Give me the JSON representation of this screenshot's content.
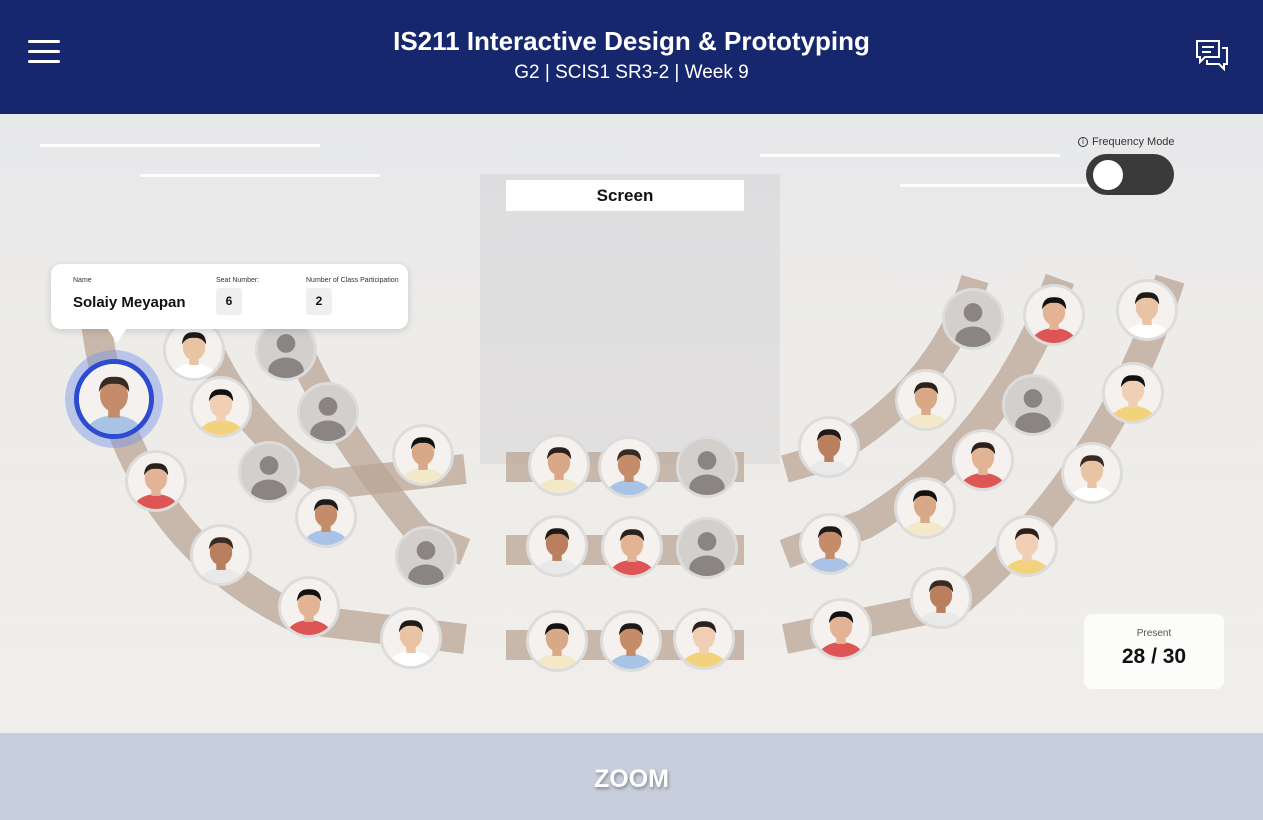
{
  "header": {
    "title": "IS211 Interactive Design & Prototyping",
    "subtitle": "G2 | SCIS1 SR3-2 | Week 9",
    "menu_icon": "hamburger-menu-icon",
    "chat_icon": "chat-bubbles-icon"
  },
  "room": {
    "screen_label": "Screen",
    "frequency_mode": {
      "label": "Frequency Mode",
      "info_icon": "info-icon",
      "enabled": false
    }
  },
  "tooltip": {
    "name_label": "Name",
    "name": "Solaiy Meyapan",
    "seat_label": "Seat Number:",
    "seat": "6",
    "participation_label": "Number of Class Participation",
    "participation": "2"
  },
  "attendance": {
    "label": "Present",
    "count": "28 / 30"
  },
  "footer": {
    "zoom_label": "ZOOM"
  },
  "colors": {
    "header_bg": "#16276d",
    "pew": "#bba595",
    "selected_ring": "#2c4bd0",
    "zoom_bar": "#c6cfdb"
  }
}
